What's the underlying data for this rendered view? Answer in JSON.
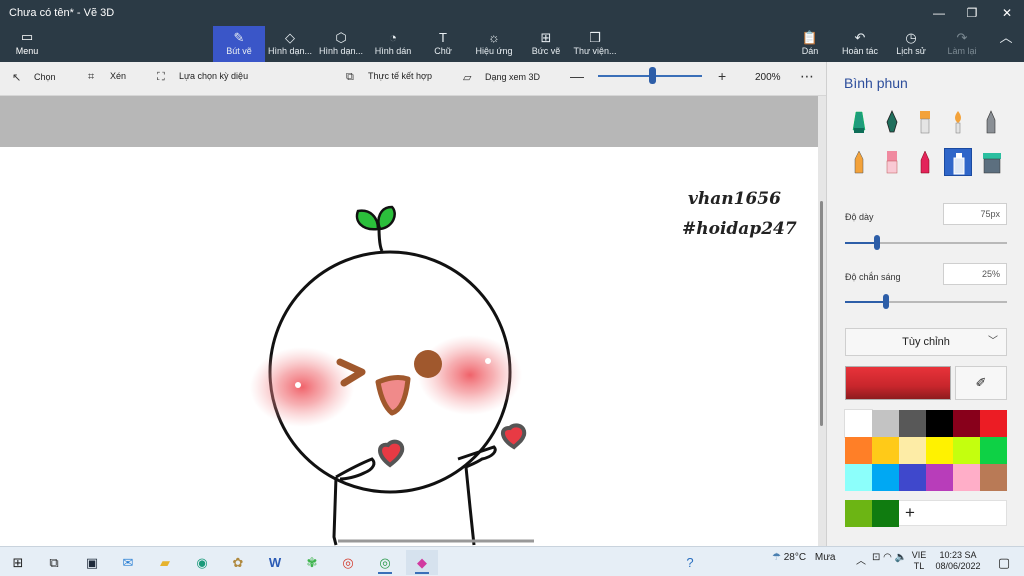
{
  "window": {
    "title": "Chưa có tên* - Vẽ 3D",
    "minimize": "—",
    "maximize": "❐",
    "close": "✕"
  },
  "ribbon": {
    "menu": "Menu",
    "tools": [
      {
        "label": "Bút vẽ",
        "icon": "brush-icon"
      },
      {
        "label": "Hình dạn...",
        "icon": "2d-shapes-icon"
      },
      {
        "label": "Hình dạn...",
        "icon": "3d-shapes-icon"
      },
      {
        "label": "Hình dán",
        "icon": "stickers-icon"
      },
      {
        "label": "Chữ",
        "icon": "text-icon"
      },
      {
        "label": "Hiệu ứng",
        "icon": "effects-icon"
      },
      {
        "label": "Bức vẽ",
        "icon": "canvas-icon"
      },
      {
        "label": "Thư viện...",
        "icon": "library-icon"
      }
    ],
    "right": {
      "paste": "Dán",
      "undo": "Hoàn tác",
      "history": "Lịch sử",
      "redo": "Làm lại"
    }
  },
  "subbar": {
    "select": "Chọn",
    "crop": "Xén",
    "magic_select": "Lựa chọn kỳ diệu",
    "mixed_reality": "Thực tế kết hợp",
    "view_3d": "Dạng xem 3D",
    "zoom": "200%",
    "zoom_level": 0.52,
    "more": "⋯"
  },
  "canvas": {
    "watermark_line1": "vhan1656",
    "watermark_line2": "#hoidap247"
  },
  "panel": {
    "title": "Bình phun",
    "selected_brush": "airbrush-icon",
    "thickness_label": "Độ dày",
    "thickness_value": "75px",
    "thickness_fraction": 0.2,
    "opacity_label": "Độ chắn sáng",
    "opacity_value": "25%",
    "opacity_fraction": 0.25,
    "dropdown": "Tùy chỉnh",
    "current_color": "#c8262c",
    "palette": [
      "#ffffff",
      "#c3c3c3",
      "#585858",
      "#000000",
      "#88001b",
      "#ec1c24",
      "#ff7f27",
      "#ffca18",
      "#fdeca6",
      "#fff200",
      "#c4ff0e",
      "#0ed145",
      "#8cfffb",
      "#00a8f3",
      "#3f48cc",
      "#b83dba",
      "#ffaec8",
      "#b97a56"
    ],
    "custom": [
      "#6cb514",
      "#107c10"
    ],
    "add": "+"
  },
  "taskbar": {
    "weather_temp": "28°C",
    "weather_desc": "Mưa",
    "lang_line1": "VIE",
    "lang_line2": "TL",
    "time": "10:23 SA",
    "date": "08/06/2022"
  }
}
